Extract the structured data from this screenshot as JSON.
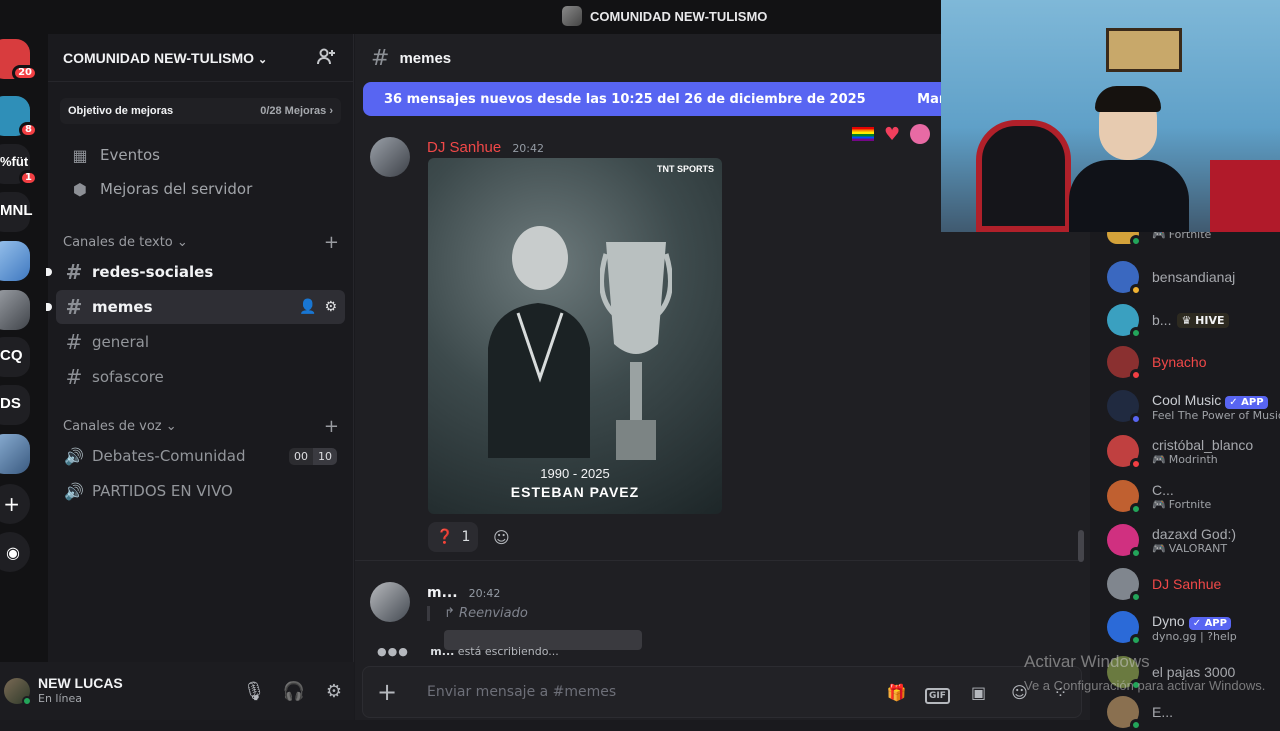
{
  "window": {
    "title": "COMUNIDAD NEW-TULISMO"
  },
  "rail": {
    "servers": [
      {
        "label": "",
        "badge": "20",
        "color": "#d83c3e"
      },
      {
        "label": "",
        "badge": "8",
        "color": "#2f8fb8"
      },
      {
        "label": "%füt",
        "badge": "1",
        "color": "#1f1f23"
      },
      {
        "label": "MNL",
        "badge": "",
        "color": "#1f1f23"
      },
      {
        "label": "",
        "badge": "",
        "color": "#4d8fd0"
      },
      {
        "label": "",
        "badge": "",
        "color": "#6a6e76"
      },
      {
        "label": "CQ",
        "badge": "",
        "color": "#1f1f23"
      },
      {
        "label": "DS",
        "badge": "",
        "color": "#1f1f23"
      },
      {
        "label": "",
        "badge": "",
        "color": "#5a7fa8"
      }
    ],
    "add_icon": "plus-icon",
    "discover_icon": "compass-icon"
  },
  "server": {
    "name": "COMUNIDAD NEW-TULISMO",
    "boost_goal": "Objetivo de mejoras",
    "boost_count": "0/28 Mejoras",
    "nav": [
      {
        "label": "Eventos",
        "icon": "calendar-icon"
      },
      {
        "label": "Mejoras del servidor",
        "icon": "boost-gem-icon"
      }
    ],
    "text_category": "Canales de texto",
    "text_channels": [
      "redes-sociales",
      "memes",
      "general",
      "sofascore"
    ],
    "voice_category": "Canales de voz",
    "voice_channels": [
      "Debates-Comunidad",
      "PARTIDOS EN VIVO"
    ],
    "voice_count_current": "00",
    "voice_count_limit": "10"
  },
  "user": {
    "name": "NEW LUCAS",
    "status": "En línea"
  },
  "chat": {
    "channel": "memes",
    "new_messages_banner": "36 mensajes nuevos desde las 10:25 del 26 de diciembre de 2025",
    "mark_read": "Marc",
    "message1": {
      "author": "DJ Sanhue",
      "time": "20:42",
      "image_brand": "TNT SPORTS",
      "image_years": "1990 - 2025",
      "image_name": "ESTEBAN PAVEZ",
      "reaction_emoji": "❓",
      "reaction_count": "1"
    },
    "message2": {
      "author": "m...",
      "time": "20:42",
      "forwarded": "Reenviado"
    },
    "typing_user": "m...",
    "typing_text": "está escribiendo...",
    "composer_placeholder": "Enviar mensaje a #memes"
  },
  "members": [
    {
      "name": "",
      "activity": "Fortnite",
      "color": "#a6a8ad",
      "avatar": "#d4a23a",
      "status": "#23a55a"
    },
    {
      "name": "bensandianaj",
      "activity": "",
      "color": "#a6a8ad",
      "avatar": "#3a68c0",
      "status": "#f0b232"
    },
    {
      "name": "b...",
      "activity": "",
      "tag": "HIVE",
      "color": "#a6a8ad",
      "avatar": "#3aa0c0",
      "status": "#23a55a"
    },
    {
      "name": "Bynacho",
      "activity": "",
      "color": "#f04848",
      "avatar": "#8a3030",
      "status": "#f23f43"
    },
    {
      "name": "Cool Music",
      "activity": "Feel The Power of Music",
      "app": "APP",
      "color": "#c9ccd1",
      "avatar": "#202a40",
      "status": "#5865f2"
    },
    {
      "name": "cristóbal_blanco",
      "activity": "Modrinth",
      "color": "#a6a8ad",
      "avatar": "#c04040",
      "status": "#f23f43"
    },
    {
      "name": "C...",
      "activity": "Fortnite",
      "color": "#a6a8ad",
      "avatar": "#c06030",
      "status": "#23a55a"
    },
    {
      "name": "dazaxd God:)",
      "activity": "VALORANT",
      "color": "#a6a8ad",
      "avatar": "#d03080",
      "status": "#23a55a"
    },
    {
      "name": "DJ Sanhue",
      "activity": "",
      "color": "#f04848",
      "avatar": "#80868e",
      "status": "#23a55a"
    },
    {
      "name": "Dyno",
      "activity": "dyno.gg | ?help",
      "app": "APP",
      "color": "#c9ccd1",
      "avatar": "#2b6ad8",
      "status": "#23a55a"
    },
    {
      "name": "el pajas 3000",
      "activity": "",
      "color": "#a6a8ad",
      "avatar": "#6a7a40",
      "status": "#23a55a"
    },
    {
      "name": "E...",
      "activity": "",
      "color": "#a6a8ad",
      "avatar": "#8a7050",
      "status": "#23a55a"
    }
  ],
  "watermark": {
    "line1": "Activar Windows",
    "line2": "Ve a Configuración para activar Windows."
  }
}
